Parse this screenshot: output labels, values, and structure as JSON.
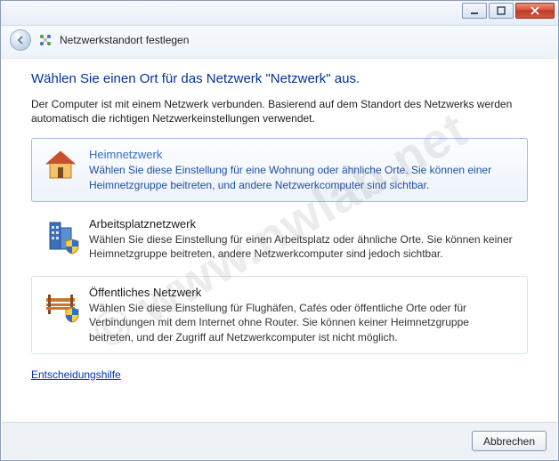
{
  "header": {
    "title": "Netzwerkstandort festlegen"
  },
  "content": {
    "heading": "Wählen Sie einen Ort für das Netzwerk \"Netzwerk\" aus.",
    "subtext": "Der Computer ist mit einem Netzwerk verbunden. Basierend auf dem Standort des Netzwerks werden automatisch die richtigen Netzwerkeinstellungen verwendet."
  },
  "options": {
    "home": {
      "title": "Heimnetzwerk",
      "desc": "Wählen Sie diese Einstellung für eine Wohnung oder ähnliche Orte. Sie können einer Heimnetzgruppe beitreten, und andere Netzwerkcomputer sind sichtbar."
    },
    "work": {
      "title": "Arbeitsplatznetzwerk",
      "desc": "Wählen Sie diese Einstellung für einen Arbeitsplatz oder ähnliche Orte. Sie können keiner Heimnetzgruppe beitreten, andere Netzwerkcomputer sind jedoch sichtbar."
    },
    "public": {
      "title": "Öffentliches Netzwerk",
      "desc": "Wählen Sie diese Einstellung für Flughäfen, Cafés oder öffentliche Orte oder für Verbindungen mit dem Internet ohne Router. Sie können keiner Heimnetzgruppe beitreten, und der Zugriff auf Netzwerkcomputer ist nicht möglich."
    }
  },
  "help_link": "Entscheidungshilfe",
  "footer": {
    "cancel": "Abbrechen"
  },
  "watermark": "© www.nwlab.net"
}
